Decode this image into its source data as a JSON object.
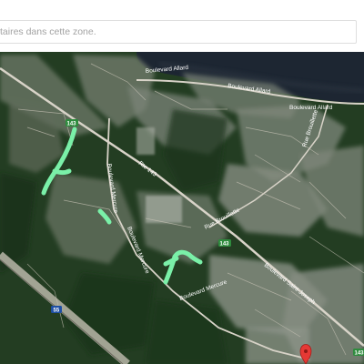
{
  "search": {
    "placeholder": "taires dans cette zone."
  },
  "map": {
    "view": "satellite",
    "road_labels": {
      "boulevard_allard_west": "Boulevard Allard",
      "boulevard_allard_east": "Boulevard Allard",
      "rue_brouillette_north": "Rue Brouillette",
      "rue_brouillette_south": "Rue Brouillette",
      "boulevard_mercure_north": "Boulevard Mercure",
      "boulevard_mercure_mid": "Boulevard Mercure",
      "boulevard_mercure_south": "Boulevard Mercure",
      "route_143": "Rte 143",
      "boulevard_saint_joseph": "Boulevard Saint-Joseph"
    },
    "route_shields": {
      "r143_a": "143",
      "r143_b": "143",
      "r143_c": "143",
      "a55": "55"
    },
    "colors": {
      "water": "#1c2430",
      "forest": "#1f3a1f",
      "urban": "#8a8f86",
      "highlight": "#7af0a8",
      "marker": "#e53935",
      "road": "#d8d3c8",
      "shield_route": "#2e8b3d",
      "shield_autoroute": "#1e4fa3"
    },
    "marker_icon": "map-pin-icon"
  }
}
